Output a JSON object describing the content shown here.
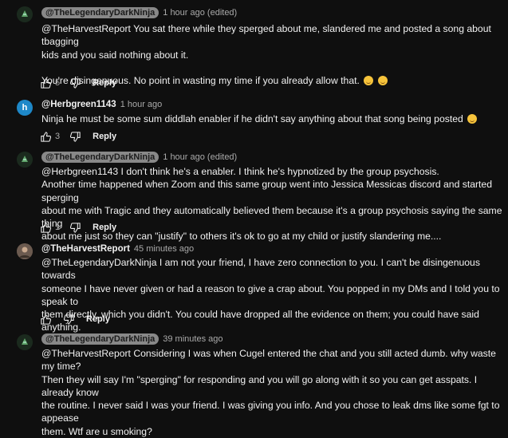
{
  "comments": [
    {
      "handle": "@TheLegendaryDarkNinja",
      "meta": "1 hour ago (edited)",
      "lines": [
        "@TheHarvestReport  You sat there while they sperged about me, slandered me and posted a song about tbagging",
        "kids and you said nothing about it.",
        "",
        "You're disingenuous. No point in wasting my time if you already allow that."
      ],
      "likes": "5",
      "reply": "Reply"
    },
    {
      "handle": "@Herbgreen1143",
      "meta": "1 hour ago",
      "avatar_letter": "h",
      "lines": [
        "Ninja he must be some sum diddlah enabler if he didn't say anything about that song being posted"
      ],
      "likes": "3",
      "reply": "Reply"
    },
    {
      "handle": "@TheLegendaryDarkNinja",
      "meta": "1 hour ago (edited)",
      "lines": [
        "@Herbgreen1143  I don't think he's a enabler. I think he's hypnotized by the group psychosis.",
        "Another time happened when Zoom and this same group went into Jessica Messicas discord and started sperging",
        "about me with Tragic and they automatically believed them because it's a group psychosis saying the same thing",
        "about me just so they can \"justify\" to others it's ok to go at my child or justify slandering me...."
      ],
      "likes": "1",
      "reply": "Reply"
    },
    {
      "handle": "@TheHarvestReport",
      "meta": "45 minutes ago",
      "lines": [
        "@TheLegendaryDarkNinja  I am not your friend, I have zero connection to you. I can't be disingenuous towards",
        "someone I have never given or had a reason to give a crap about. You popped in my DMs and I told you to speak to",
        "them directly, which you didn't. You could have dropped all the evidence on them; you could have said anything."
      ],
      "ellipsis": "...",
      "reply": "Reply"
    },
    {
      "handle": "@TheLegendaryDarkNinja",
      "meta": "39 minutes ago",
      "lines": [
        "@TheHarvestReport  Considering I was when Cugel entered the chat and you still acted dumb. why waste my time?",
        "Then they will say I'm \"sperging\" for responding and you will go along with it so you can get asspats. I already know",
        "the routine. I never said I was your friend. I was giving you info. And you chose to leak dms like some fgt to appease",
        "them. Wtf are u smoking?"
      ]
    }
  ],
  "colors": {
    "background": "#0f0f0f",
    "text": "#f1f1f1",
    "muted": "#aaaaaa",
    "pill": "#888888"
  },
  "icons": [
    "ninja-avatar",
    "like-icon",
    "dislike-icon",
    "laugh-emoji-icon",
    "thinking-emoji-icon"
  ]
}
